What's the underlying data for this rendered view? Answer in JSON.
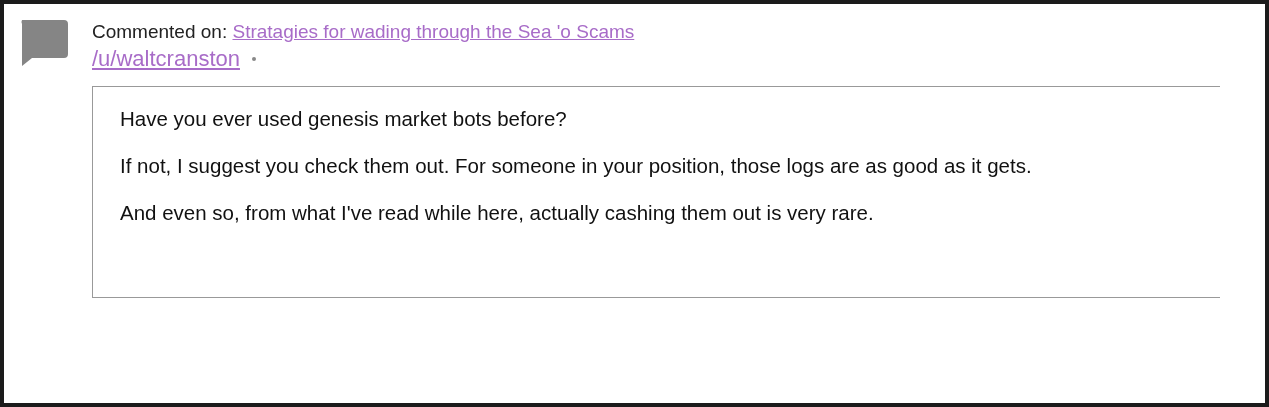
{
  "comment": {
    "label": "Commented on:",
    "thread_title": "Stratagies for wading through the Sea 'o Scams",
    "author": "/u/waltcranston",
    "paragraphs": [
      "Have you ever used genesis market bots before?",
      "If not, I suggest you check them out. For someone in your position, those logs are as good as it gets.",
      "And even so, from what I've read while here, actually cashing them out is very rare."
    ]
  }
}
